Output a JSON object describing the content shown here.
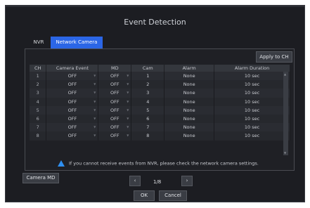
{
  "dialog": {
    "title": "Event Detection"
  },
  "tabs": [
    {
      "label": "NVR"
    },
    {
      "label": "Network Camera"
    }
  ],
  "apply_label": "Apply to CH",
  "columns": [
    "CH",
    "Camera Event",
    "MD",
    "Cam",
    "Alarm",
    "Alarm Duration"
  ],
  "rows": [
    {
      "ch": "1",
      "event": "OFF",
      "md": "OFF",
      "cam": "1",
      "alarm": "None",
      "duration": "10 sec"
    },
    {
      "ch": "2",
      "event": "OFF",
      "md": "OFF",
      "cam": "2",
      "alarm": "None",
      "duration": "10 sec"
    },
    {
      "ch": "3",
      "event": "OFF",
      "md": "OFF",
      "cam": "3",
      "alarm": "None",
      "duration": "10 sec"
    },
    {
      "ch": "4",
      "event": "OFF",
      "md": "OFF",
      "cam": "4",
      "alarm": "None",
      "duration": "10 sec"
    },
    {
      "ch": "5",
      "event": "OFF",
      "md": "OFF",
      "cam": "5",
      "alarm": "None",
      "duration": "10 sec"
    },
    {
      "ch": "6",
      "event": "OFF",
      "md": "OFF",
      "cam": "6",
      "alarm": "None",
      "duration": "10 sec"
    },
    {
      "ch": "7",
      "event": "OFF",
      "md": "OFF",
      "cam": "7",
      "alarm": "None",
      "duration": "10 sec"
    },
    {
      "ch": "8",
      "event": "OFF",
      "md": "OFF",
      "cam": "8",
      "alarm": "None",
      "duration": "10 sec"
    }
  ],
  "warning": "If you cannot receive events from NVR, please check the network camera settings.",
  "camera_md_label": "Camera MD",
  "pagination": {
    "current": "1/8",
    "prev": "‹",
    "next": "›"
  },
  "footer": {
    "ok": "OK",
    "cancel": "Cancel"
  }
}
